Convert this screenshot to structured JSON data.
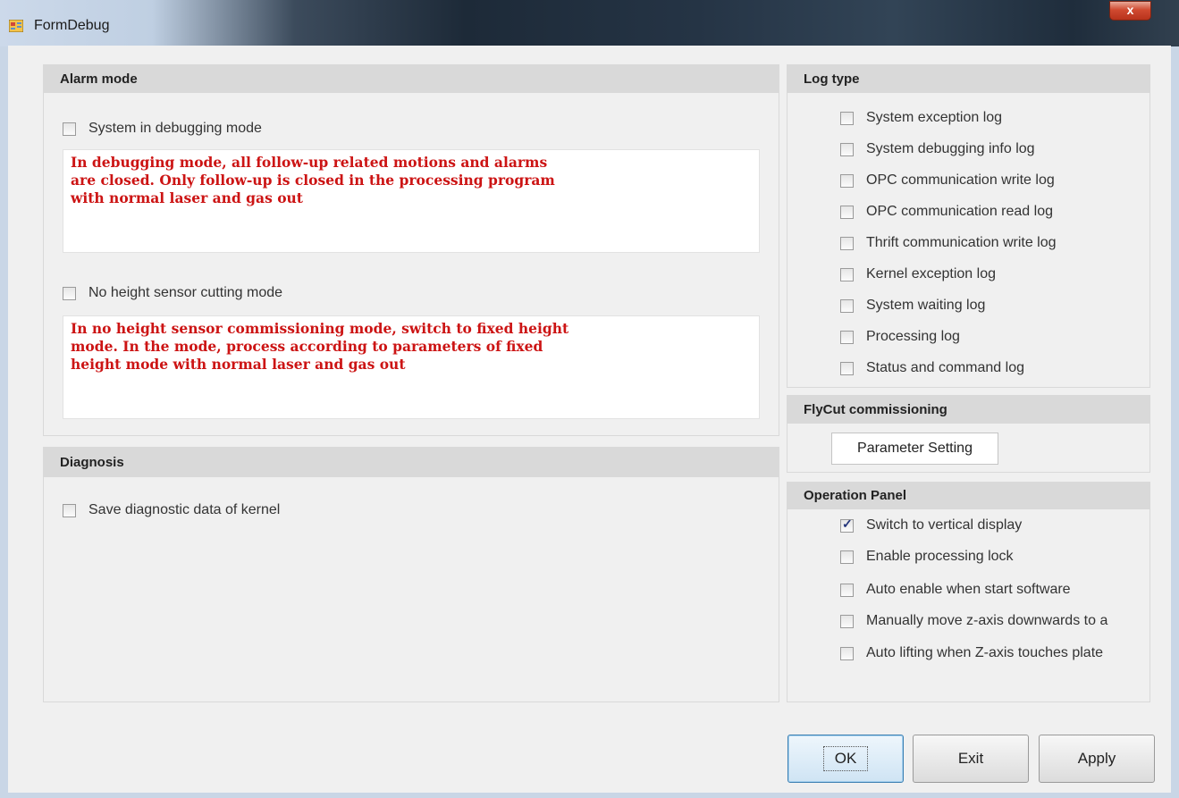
{
  "window": {
    "title": "FormDebug",
    "close_glyph": "x"
  },
  "alarm_mode": {
    "title": "Alarm mode",
    "debug_checkbox": {
      "label": "System in debugging mode",
      "checked": false
    },
    "debug_note": "In debugging mode, all follow-up related motions and alarms\nare closed. Only follow-up is closed in the processing program\nwith normal laser and gas out",
    "no_height_checkbox": {
      "label": "No height sensor cutting mode",
      "checked": false
    },
    "no_height_note": "In no height sensor commissioning mode, switch to fixed height\nmode. In the mode, process according to parameters of fixed\nheight mode with normal laser and gas out"
  },
  "diagnosis": {
    "title": "Diagnosis",
    "save_checkbox": {
      "label": "Save diagnostic data of kernel",
      "checked": false
    }
  },
  "log_type": {
    "title": "Log type",
    "items": [
      {
        "label": "System exception log",
        "checked": false
      },
      {
        "label": "System debugging info log",
        "checked": false
      },
      {
        "label": "OPC communication write log",
        "checked": false
      },
      {
        "label": "OPC communication read log",
        "checked": false
      },
      {
        "label": "Thrift communication write log",
        "checked": false
      },
      {
        "label": "Kernel exception log",
        "checked": false
      },
      {
        "label": "System waiting log",
        "checked": false
      },
      {
        "label": "Processing log",
        "checked": false
      },
      {
        "label": "Status and command log",
        "checked": false
      }
    ]
  },
  "flycut": {
    "title": "FlyCut commissioning",
    "button_label": "Parameter Setting"
  },
  "operation_panel": {
    "title": "Operation Panel",
    "items": [
      {
        "label": "Switch to vertical display",
        "checked": true
      },
      {
        "label": "Enable processing lock",
        "checked": false
      },
      {
        "label": "Auto enable when start software",
        "checked": false
      },
      {
        "label": "Manually move z-axis downwards to a",
        "checked": false
      },
      {
        "label": "Auto lifting when Z-axis touches plate",
        "checked": false
      }
    ]
  },
  "buttons": {
    "ok": "OK",
    "exit": "Exit",
    "apply": "Apply"
  },
  "icons": {
    "app": "form-app-icon",
    "close": "close-icon",
    "check": "checkmark-icon"
  },
  "colors": {
    "note_text": "#cc1414",
    "group_header_bg": "#d9d9d9",
    "close_button": "#c8402a",
    "default_button_border": "#3c7fb1"
  }
}
